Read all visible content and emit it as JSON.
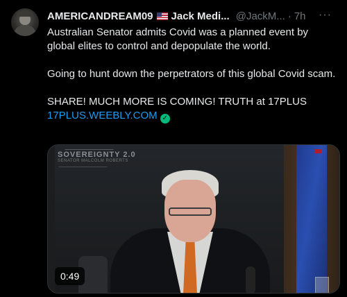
{
  "author": {
    "display_name": "AMERICANDREAM09",
    "display_name_suffix": "Jack Medi...",
    "handle": "@JackM...",
    "separator": "·",
    "timestamp": "7h"
  },
  "more_icon": "···",
  "body": {
    "line1": "Australian Senator admits Covid was a planned event by global elites to control and depopulate the world.",
    "line2": "Going to hunt down the perpetrators of this global Covid scam.",
    "line3": "SHARE! MUCH MORE IS COMING! TRUTH at 17PLUS",
    "link": "17PLUS.WEEBLY.COM"
  },
  "media": {
    "watermark": "SOVEREIGNTY 2.0",
    "watermark_sub": "SENATOR MALCOLM ROBERTS",
    "duration": "0:49"
  },
  "icons": {
    "flag": "us-flag-icon",
    "verified": "verified-check-icon",
    "more": "more-icon"
  },
  "colors": {
    "accent": "#1d9bf0",
    "verified": "#00ba7c",
    "muted": "#71767b",
    "text": "#e7e9ea",
    "background": "#000000"
  }
}
